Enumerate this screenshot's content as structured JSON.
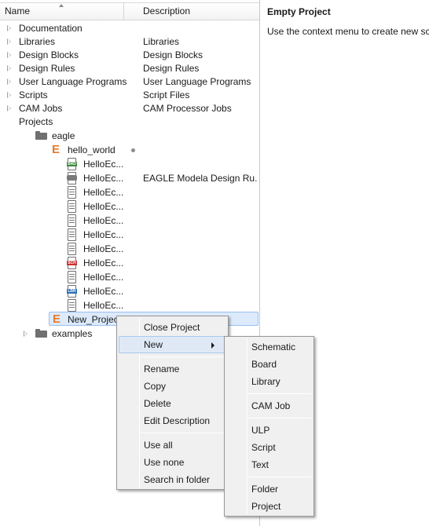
{
  "tree": {
    "columns": {
      "name": "Name",
      "description": "Description"
    },
    "rows": [
      {
        "label": "Documentation",
        "desc": ""
      },
      {
        "label": "Libraries",
        "desc": "Libraries"
      },
      {
        "label": "Design Blocks",
        "desc": "Design Blocks"
      },
      {
        "label": "Design Rules",
        "desc": "Design Rules"
      },
      {
        "label": "User Language Programs",
        "desc": "User Language Programs"
      },
      {
        "label": "Scripts",
        "desc": "Script Files"
      },
      {
        "label": "CAM Jobs",
        "desc": "CAM Processor Jobs"
      },
      {
        "label": "Projects",
        "desc": ""
      },
      {
        "label": "eagle",
        "desc": ""
      },
      {
        "label": "hello_world",
        "desc": ""
      },
      {
        "label": "HelloEc...",
        "desc": ""
      },
      {
        "label": "HelloEc...",
        "desc": "EAGLE Modela Design Ru..."
      },
      {
        "label": "HelloEc...",
        "desc": ""
      },
      {
        "label": "HelloEc...",
        "desc": ""
      },
      {
        "label": "HelloEc...",
        "desc": ""
      },
      {
        "label": "HelloEc...",
        "desc": ""
      },
      {
        "label": "HelloEc...",
        "desc": ""
      },
      {
        "label": "HelloEc...",
        "desc": ""
      },
      {
        "label": "HelloEc...",
        "desc": ""
      },
      {
        "label": "HelloEc...",
        "desc": ""
      },
      {
        "label": "HelloEc...",
        "desc": ""
      },
      {
        "label": "New_Project",
        "desc": ""
      },
      {
        "label": "examples",
        "desc": ""
      }
    ],
    "file_tags": {
      "brd": "BRD",
      "sch": "SCH",
      "lbr": "LBR"
    }
  },
  "info": {
    "title": "Empty Project",
    "text": "Use the context menu to create new schem"
  },
  "context_menu": {
    "items": [
      "Close Project",
      "New",
      "Rename",
      "Copy",
      "Delete",
      "Edit Description",
      "Use all",
      "Use none",
      "Search in folder"
    ]
  },
  "new_submenu": {
    "items": [
      "Schematic",
      "Board",
      "Library",
      "CAM Job",
      "ULP",
      "Script",
      "Text",
      "Folder",
      "Project"
    ]
  }
}
